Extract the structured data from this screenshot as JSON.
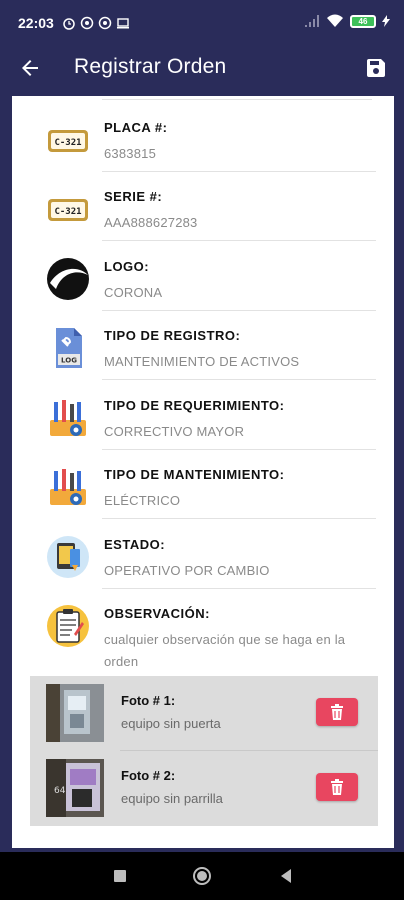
{
  "status": {
    "time": "22:03",
    "battery": "46"
  },
  "header": {
    "title": "Registrar Orden"
  },
  "fields": [
    {
      "label": "PLACA #:",
      "value": "6383815",
      "icon": "plate-icon"
    },
    {
      "label": "SERIE #:",
      "value": "AAA888627283",
      "icon": "plate-icon"
    },
    {
      "label": "LOGO:",
      "value": "CORONA",
      "icon": "logo-icon"
    },
    {
      "label": "TIPO DE REGISTRO:",
      "value": "MANTENIMIENTO DE ACTIVOS",
      "icon": "log-file-icon"
    },
    {
      "label": "TIPO DE REQUERIMIENTO:",
      "value": "CORRECTIVO MAYOR",
      "icon": "tools-icon"
    },
    {
      "label": "TIPO DE MANTENIMIENTO:",
      "value": "ELÉCTRICO",
      "icon": "tools-icon"
    },
    {
      "label": "ESTADO:",
      "value": "OPERATIVO POR CAMBIO",
      "icon": "status-device-icon"
    },
    {
      "label": "OBSERVACIÓN:",
      "value": "cualquier observación que se haga en la orden",
      "icon": "clipboard-icon"
    }
  ],
  "plate_text": "C-321",
  "photos": [
    {
      "title": "Foto # 1:",
      "desc": "equipo sin puerta"
    },
    {
      "title": "Foto # 2:",
      "desc": "equipo sin parrilla"
    }
  ],
  "colors": {
    "primary": "#2a2c5a",
    "delete": "#e84660",
    "photo_bg": "#dcdcdc"
  }
}
